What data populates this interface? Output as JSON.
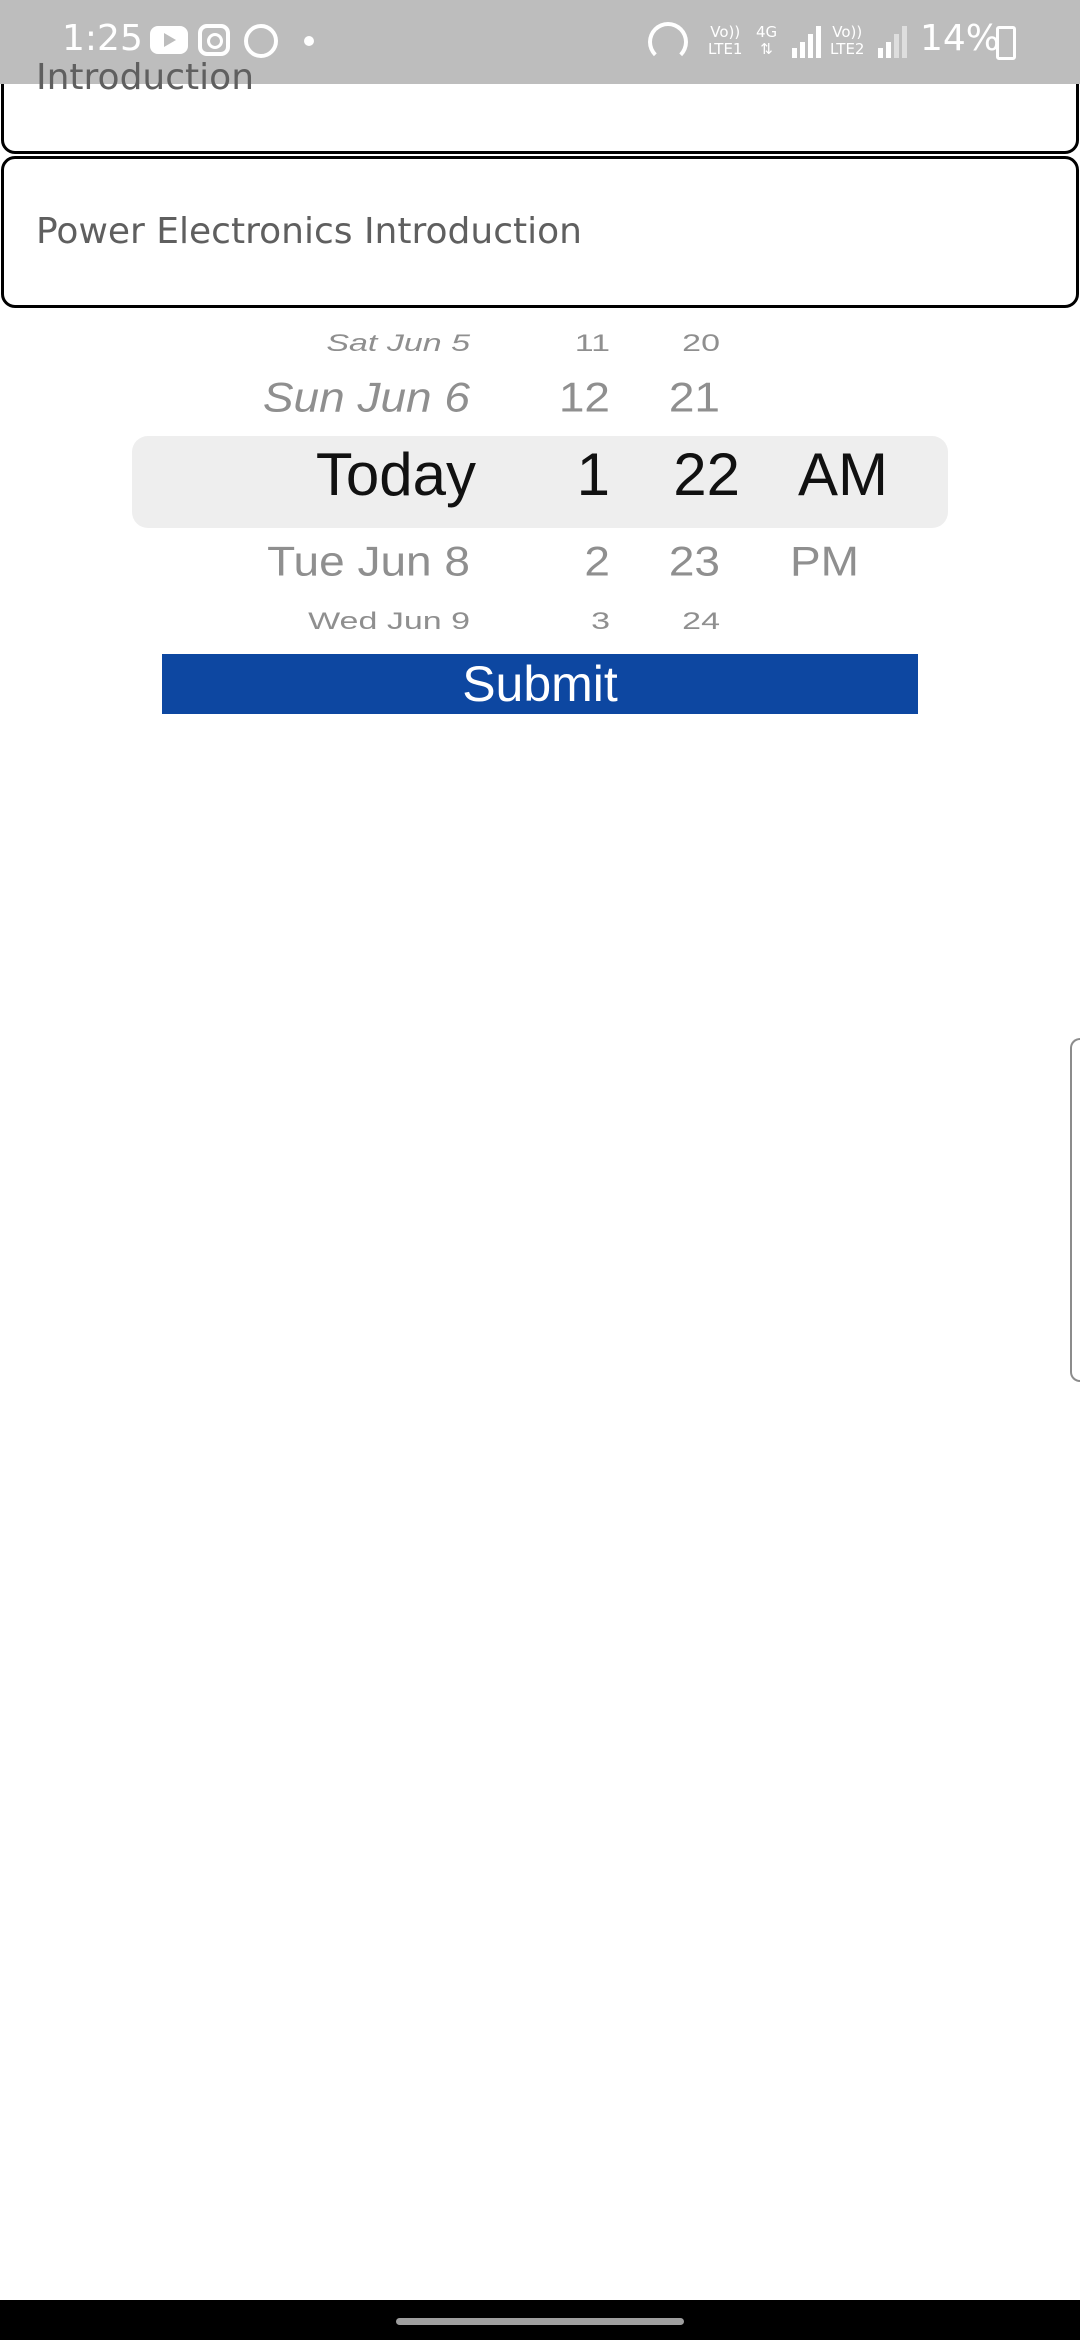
{
  "status_bar": {
    "time": "1:25",
    "net1_top": "Vo))",
    "net1_bottom": "LTE1",
    "net_type": "4G",
    "net2_top": "Vo))",
    "net2_bottom": "LTE2",
    "battery": "14%",
    "icons": [
      "youtube-icon",
      "instagram-icon",
      "whatsapp-icon",
      "hotspot-icon",
      "signal-icon",
      "battery-charging-icon"
    ]
  },
  "cards": {
    "first_label": "Introduction",
    "second_label": "Power Electronics Introduction"
  },
  "picker": {
    "days": [
      "Sat Jun 5",
      "Sun Jun 6",
      "Today",
      "Tue Jun 8",
      "Wed Jun 9"
    ],
    "hours": [
      "11",
      "12",
      "1",
      "2",
      "3"
    ],
    "minutes": [
      "20",
      "21",
      "22",
      "23",
      "24"
    ],
    "ampm": [
      "AM",
      "PM"
    ],
    "selected": {
      "day": "Today",
      "hour": "1",
      "minute": "22",
      "ampm": "AM"
    }
  },
  "submit_label": "Submit",
  "colors": {
    "status_bar_bg": "#bdbdbd",
    "submit_bg": "#0d47a1",
    "picker_highlight": "#eeeeee",
    "nav_bar": "#000000"
  }
}
